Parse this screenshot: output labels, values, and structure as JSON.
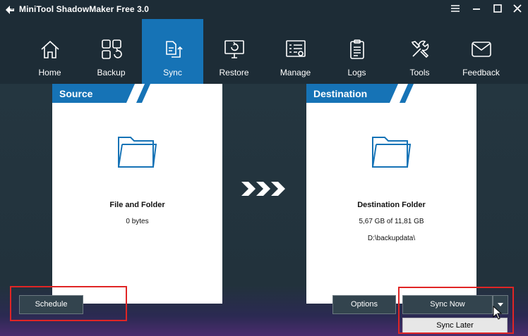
{
  "window": {
    "title": "MiniTool ShadowMaker Free 3.0",
    "icons": {
      "logo": "shadowmaker-logo-icon",
      "menu": "hamburger-icon",
      "minimize": "minimize-icon",
      "maximize": "maximize-icon",
      "close": "close-icon"
    }
  },
  "nav": {
    "items": [
      {
        "label": "Home",
        "icon": "home-icon"
      },
      {
        "label": "Backup",
        "icon": "backup-icon"
      },
      {
        "label": "Sync",
        "icon": "sync-icon",
        "active": true
      },
      {
        "label": "Restore",
        "icon": "restore-icon"
      },
      {
        "label": "Manage",
        "icon": "manage-icon"
      },
      {
        "label": "Logs",
        "icon": "logs-icon"
      },
      {
        "label": "Tools",
        "icon": "tools-icon"
      },
      {
        "label": "Feedback",
        "icon": "feedback-icon"
      }
    ]
  },
  "source": {
    "header": "Source",
    "title": "File and Folder",
    "size": "0 bytes",
    "icon": "folder-icon"
  },
  "destination": {
    "header": "Destination",
    "title": "Destination Folder",
    "size": "5,67 GB of 11,81 GB",
    "path": "D:\\backupdata\\",
    "icon": "folder-icon"
  },
  "buttons": {
    "schedule": "Schedule",
    "options": "Options",
    "sync_now": "Sync Now",
    "sync_later": "Sync Later"
  },
  "colors": {
    "accent": "#1673b6",
    "titlebar": "#1d2c36",
    "highlight": "#e02525"
  }
}
